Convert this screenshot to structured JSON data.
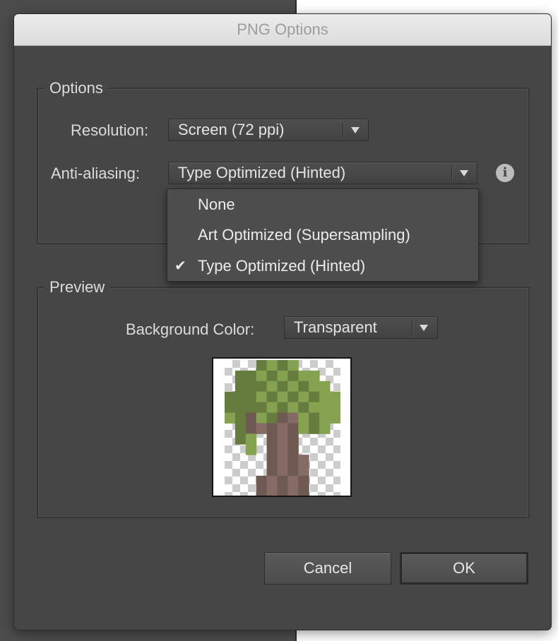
{
  "dialog": {
    "title": "PNG Options"
  },
  "options": {
    "group_title": "Options",
    "resolution_label": "Resolution:",
    "resolution_value": "Screen (72 ppi)",
    "antialiasing_label": "Anti-aliasing:",
    "antialiasing_value": "Type Optimized (Hinted)",
    "info_icon": "i",
    "antialiasing_menu": [
      {
        "label": "None",
        "checked": false
      },
      {
        "label": "Art Optimized (Supersampling)",
        "checked": false
      },
      {
        "label": "Type Optimized (Hinted)",
        "checked": true
      }
    ],
    "check_glyph": "✔"
  },
  "preview": {
    "group_title": "Preview",
    "background_color_label": "Background Color:",
    "background_color_value": "Transparent",
    "image_icon": "pixel-tree-icon"
  },
  "buttons": {
    "cancel": "Cancel",
    "ok": "OK"
  },
  "colors": {
    "dialog_bg": "#464646",
    "leaf_dark": "#667b3e",
    "leaf_light": "#84a24f",
    "trunk_dark": "#6f5a52",
    "trunk_light": "#866b64",
    "checker_light": "#ffffff",
    "checker_dark": "#cccccc"
  }
}
